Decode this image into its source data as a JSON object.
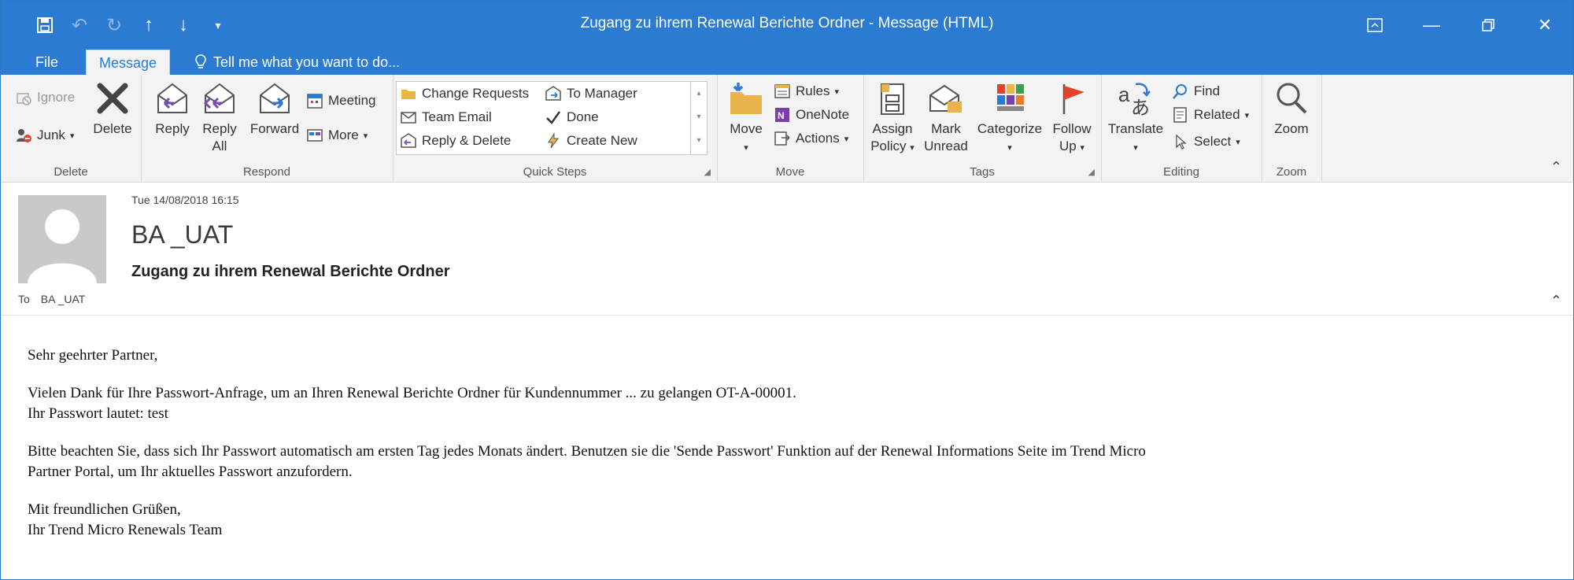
{
  "window": {
    "title": "Zugang zu ihrem  Renewal Berichte Ordner - Message (HTML)"
  },
  "menu": {
    "file": "File",
    "message": "Message",
    "tell": "Tell me what you want to do..."
  },
  "ribbon": {
    "delete": {
      "ignore": "Ignore",
      "junk": "Junk",
      "delete": "Delete",
      "label": "Delete"
    },
    "respond": {
      "reply": "Reply",
      "reply_all_1": "Reply",
      "reply_all_2": "All",
      "forward": "Forward",
      "meeting": "Meeting",
      "more": "More",
      "label": "Respond"
    },
    "quicksteps": {
      "change_requests": "Change Requests",
      "to_manager": "To Manager",
      "team_email": "Team Email",
      "done": "Done",
      "reply_delete": "Reply & Delete",
      "create_new": "Create New",
      "label": "Quick Steps"
    },
    "move": {
      "move": "Move",
      "rules": "Rules",
      "onenote": "OneNote",
      "actions": "Actions",
      "label": "Move"
    },
    "tags": {
      "assign_1": "Assign",
      "assign_2": "Policy",
      "mark_1": "Mark",
      "mark_2": "Unread",
      "categorize": "Categorize",
      "follow_1": "Follow",
      "follow_2": "Up",
      "label": "Tags"
    },
    "editing": {
      "translate": "Translate",
      "find": "Find",
      "related": "Related",
      "select": "Select",
      "label": "Editing"
    },
    "zoom": {
      "zoom": "Zoom",
      "label": "Zoom"
    }
  },
  "header": {
    "date": "Tue 14/08/2018 16:15",
    "sender": "BA _UAT",
    "subject": "Zugang zu ihrem  Renewal Berichte Ordner",
    "to_label": "To",
    "to_value": "BA _UAT"
  },
  "body": {
    "greeting": "Sehr geehrter Partner,",
    "p1_line1": "Vielen Dank für Ihre Passwort-Anfrage, um an Ihren Renewal Berichte Ordner für Kundennummer ... zu gelangen OT-A-00001.",
    "p1_line2": "Ihr Passwort lautet: test",
    "p2_line1": "Bitte beachten Sie, dass sich Ihr Passwort automatisch am ersten Tag jedes Monats ändert. Benutzen sie die 'Sende Passwort' Funktion auf der Renewal Informations Seite im Trend Micro",
    "p2_line2": "Partner Portal, um Ihr aktuelles Passwort anzufordern.",
    "closing1": "Mit freundlichen Grüßen,",
    "closing2": "Ihr Trend Micro Renewals Team"
  },
  "colors": {
    "accent": "#2b7bd2",
    "ribbon_bg": "#f3f3f3"
  }
}
